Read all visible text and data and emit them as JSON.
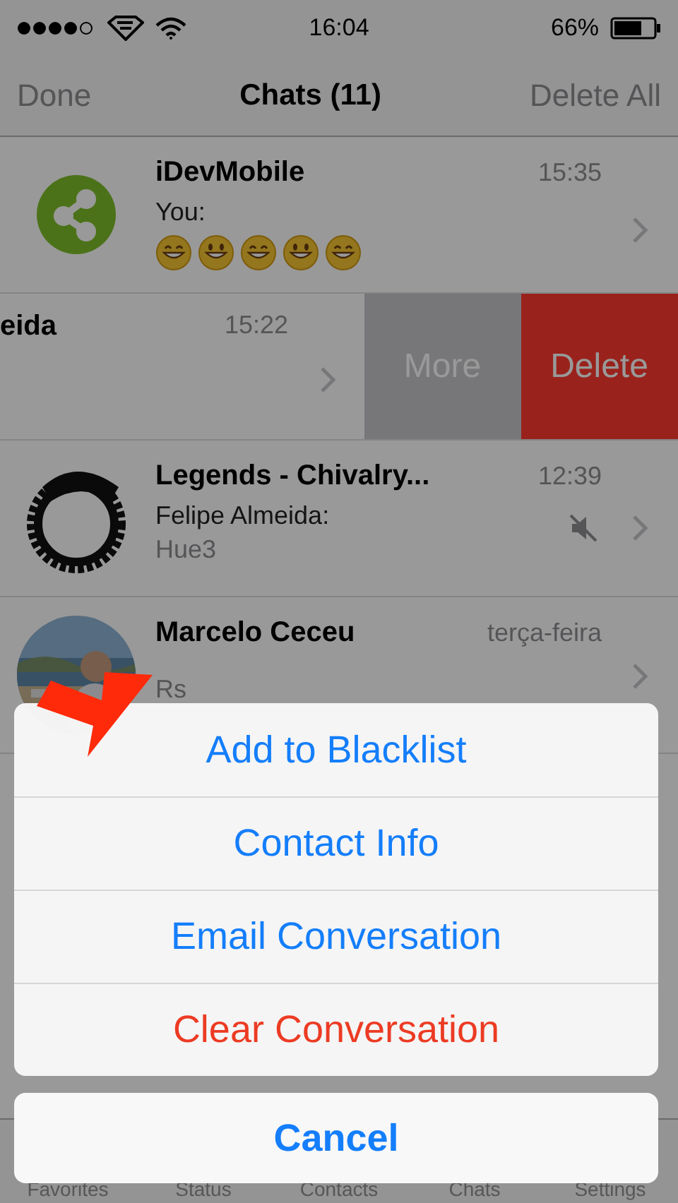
{
  "status_bar": {
    "time": "16:04",
    "battery": "66%"
  },
  "nav": {
    "left": "Done",
    "title": "Chats (11)",
    "right": "Delete All"
  },
  "chats": [
    {
      "avatar": {
        "kind": "logo"
      },
      "name": "iDevMobile",
      "time": "15:35",
      "lines": [
        {
          "text": "You:",
          "kind": "sender"
        }
      ],
      "emojis": [
        {
          "kind": "grin"
        },
        {
          "kind": "smile"
        },
        {
          "kind": "grin"
        },
        {
          "kind": "smile"
        },
        {
          "kind": "grin"
        }
      ],
      "muted": false,
      "swiped": false
    },
    {
      "name": "eida",
      "time": "15:22",
      "muted": false,
      "swiped": true,
      "actions": [
        {
          "label": "More",
          "kind": "more"
        },
        {
          "label": "Delete",
          "kind": "delete"
        }
      ]
    },
    {
      "avatar": {
        "kind": "ring"
      },
      "name": "Legends - Chivalry...",
      "time": "12:39",
      "lines": [
        {
          "text": "Felipe Almeida:",
          "kind": "sender"
        },
        {
          "text": "Hue3",
          "kind": "message"
        }
      ],
      "muted": true,
      "swiped": false
    },
    {
      "avatar": {
        "kind": "picture"
      },
      "name": "Marcelo Ceceu",
      "time": "terça-feira",
      "lines": [
        {
          "text": "Rs",
          "kind": "message"
        }
      ],
      "muted": false,
      "swiped": false
    }
  ],
  "tabs": [
    "Favorites",
    "Status",
    "Contacts",
    "Chats",
    "Settings"
  ],
  "action_sheet": {
    "items": [
      {
        "label": "Add to Blacklist",
        "kind": "default"
      },
      {
        "label": "Contact Info",
        "kind": "default"
      },
      {
        "label": "Email Conversation",
        "kind": "default"
      },
      {
        "label": "Clear Conversation",
        "kind": "destructive"
      }
    ],
    "cancel": "Cancel"
  }
}
